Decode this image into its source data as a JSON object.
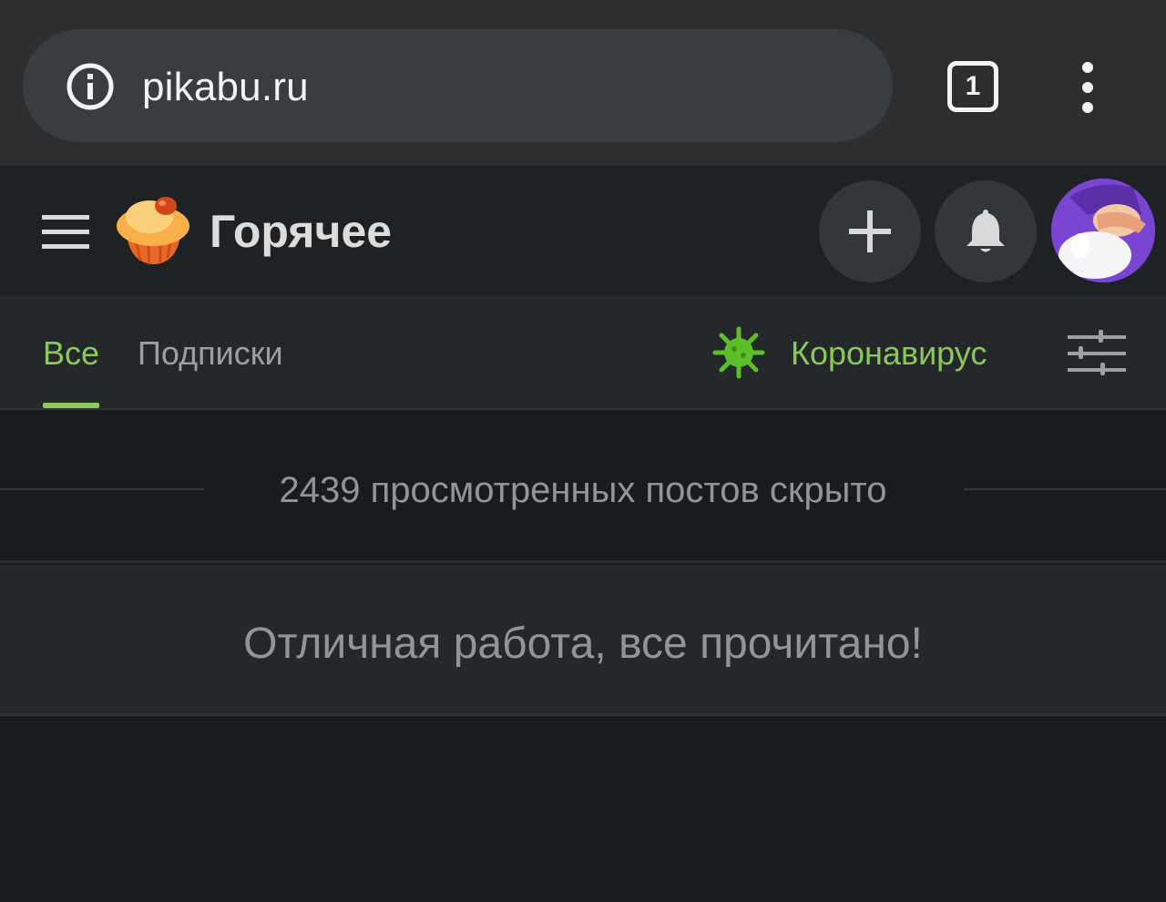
{
  "browser": {
    "url": "pikabu.ru",
    "tab_count": "1"
  },
  "header": {
    "title": "Горячее"
  },
  "tabs": {
    "all": "Все",
    "subscriptions": "Подписки",
    "active": "all"
  },
  "special_link": {
    "label": "Коронавирус"
  },
  "feed": {
    "hidden_posts_text": "2439 просмотренных постов скрыто",
    "all_read_text": "Отличная работа, все прочитано!"
  },
  "colors": {
    "accent_green": "#8ac858",
    "background": "#191c1f",
    "header_bg": "#1f2225",
    "browser_bg": "#2d2e30"
  },
  "icons": [
    "info-icon",
    "tabs-icon",
    "more-vert-icon",
    "hamburger-icon",
    "pikabu-logo",
    "plus-icon",
    "bell-icon",
    "avatar",
    "virus-icon",
    "filter-sliders-icon"
  ]
}
